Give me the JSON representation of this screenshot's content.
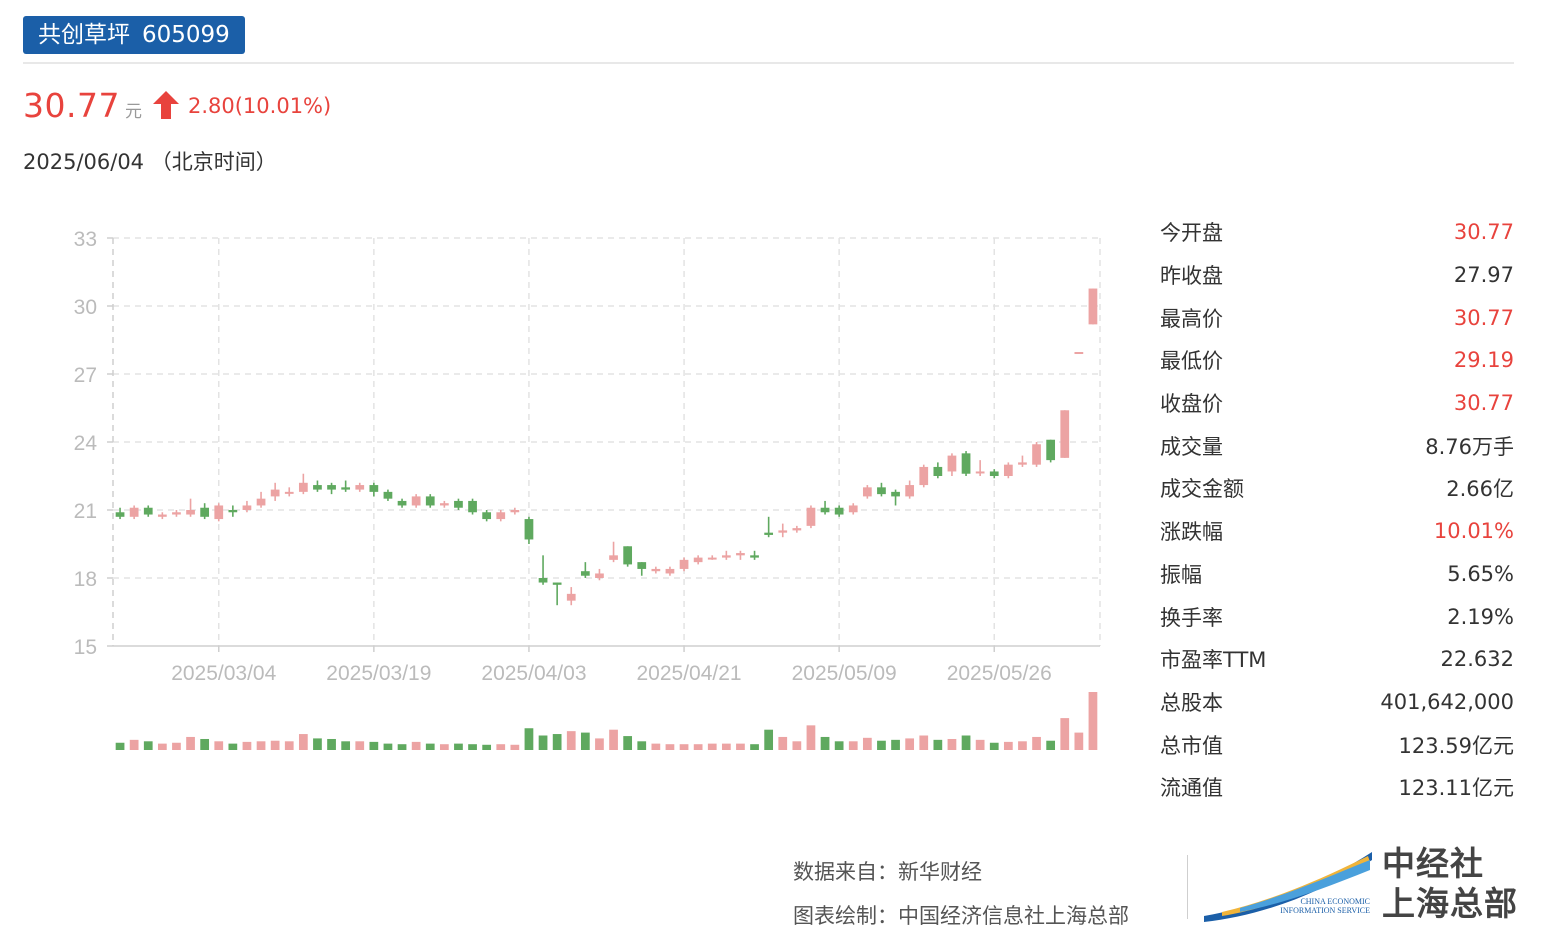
{
  "header": {
    "stock_name": "共创草坪",
    "stock_code": "605099",
    "price": "30.77",
    "price_unit": "元",
    "change": "2.80(10.01%)",
    "date": "2025/06/04 （北京时间）"
  },
  "colors": {
    "up": "#e8433d",
    "candle_up": "#eca3a3",
    "candle_down": "#5fa95f",
    "tag_bg": "#1b5fa8"
  },
  "stats": [
    {
      "label": "今开盘",
      "value": "30.77",
      "highlight": true
    },
    {
      "label": "昨收盘",
      "value": "27.97",
      "highlight": false
    },
    {
      "label": "最高价",
      "value": "30.77",
      "highlight": true
    },
    {
      "label": "最低价",
      "value": "29.19",
      "highlight": true
    },
    {
      "label": "收盘价",
      "value": "30.77",
      "highlight": true
    },
    {
      "label": "成交量",
      "value": "8.76万手",
      "highlight": false
    },
    {
      "label": "成交金额",
      "value": "2.66亿",
      "highlight": false
    },
    {
      "label": "涨跌幅",
      "value": "10.01%",
      "highlight": true
    },
    {
      "label": "振幅",
      "value": "5.65%",
      "highlight": false
    },
    {
      "label": "换手率",
      "value": "2.19%",
      "highlight": false
    },
    {
      "label": "市盈率TTM",
      "value": "22.632",
      "highlight": false
    },
    {
      "label": "总股本",
      "value": "401,642,000",
      "highlight": false
    },
    {
      "label": "总市值",
      "value": "123.59亿元",
      "highlight": false
    },
    {
      "label": "流通值",
      "value": "123.11亿元",
      "highlight": false
    }
  ],
  "footer": {
    "source": "数据来自：新华财经",
    "credit": "图表绘制：中国经济信息社上海总部",
    "logo_line1": "中经社",
    "logo_line2": "上海总部",
    "logo_small1": "CHINA ECONOMIC",
    "logo_small2": "INFORMATION SERVICE"
  },
  "chart_data": {
    "type": "candlestick",
    "y_ticks": [
      33,
      30,
      27,
      24,
      21,
      18,
      15
    ],
    "ylim": [
      15,
      33
    ],
    "x_tick_labels": [
      "2025/03/04",
      "2025/03/19",
      "2025/04/03",
      "2025/04/21",
      "2025/05/09",
      "2025/05/26"
    ],
    "x_tick_indices": [
      7,
      18,
      29,
      40,
      51,
      62
    ],
    "grid": true,
    "candles": [
      {
        "o": 20.9,
        "c": 20.7,
        "h": 21.1,
        "l": 20.6,
        "v": 0.25
      },
      {
        "o": 20.7,
        "c": 21.1,
        "h": 21.2,
        "l": 20.6,
        "v": 0.35
      },
      {
        "o": 21.1,
        "c": 20.8,
        "h": 21.2,
        "l": 20.7,
        "v": 0.3
      },
      {
        "o": 20.7,
        "c": 20.8,
        "h": 20.9,
        "l": 20.6,
        "v": 0.22
      },
      {
        "o": 20.8,
        "c": 20.9,
        "h": 21.0,
        "l": 20.7,
        "v": 0.25
      },
      {
        "o": 20.8,
        "c": 21.0,
        "h": 21.5,
        "l": 20.7,
        "v": 0.45
      },
      {
        "o": 21.1,
        "c": 20.7,
        "h": 21.3,
        "l": 20.6,
        "v": 0.38
      },
      {
        "o": 20.6,
        "c": 21.2,
        "h": 21.3,
        "l": 20.5,
        "v": 0.3
      },
      {
        "o": 21.0,
        "c": 20.9,
        "h": 21.2,
        "l": 20.7,
        "v": 0.22
      },
      {
        "o": 21.0,
        "c": 21.2,
        "h": 21.4,
        "l": 20.9,
        "v": 0.28
      },
      {
        "o": 21.2,
        "c": 21.5,
        "h": 21.8,
        "l": 21.1,
        "v": 0.3
      },
      {
        "o": 21.6,
        "c": 21.9,
        "h": 22.2,
        "l": 21.4,
        "v": 0.32
      },
      {
        "o": 21.8,
        "c": 21.8,
        "h": 22.0,
        "l": 21.6,
        "v": 0.3
      },
      {
        "o": 21.8,
        "c": 22.2,
        "h": 22.6,
        "l": 21.7,
        "v": 0.55
      },
      {
        "o": 22.1,
        "c": 21.9,
        "h": 22.3,
        "l": 21.8,
        "v": 0.4
      },
      {
        "o": 22.1,
        "c": 21.9,
        "h": 22.2,
        "l": 21.7,
        "v": 0.38
      },
      {
        "o": 22.0,
        "c": 21.9,
        "h": 22.3,
        "l": 21.8,
        "v": 0.3
      },
      {
        "o": 21.9,
        "c": 22.1,
        "h": 22.2,
        "l": 21.8,
        "v": 0.3
      },
      {
        "o": 22.1,
        "c": 21.8,
        "h": 22.2,
        "l": 21.6,
        "v": 0.28
      },
      {
        "o": 21.8,
        "c": 21.5,
        "h": 21.9,
        "l": 21.4,
        "v": 0.22
      },
      {
        "o": 21.4,
        "c": 21.2,
        "h": 21.5,
        "l": 21.1,
        "v": 0.2
      },
      {
        "o": 21.2,
        "c": 21.6,
        "h": 21.7,
        "l": 21.1,
        "v": 0.28
      },
      {
        "o": 21.6,
        "c": 21.2,
        "h": 21.7,
        "l": 21.1,
        "v": 0.22
      },
      {
        "o": 21.2,
        "c": 21.3,
        "h": 21.4,
        "l": 21.1,
        "v": 0.2
      },
      {
        "o": 21.4,
        "c": 21.1,
        "h": 21.5,
        "l": 21.0,
        "v": 0.22
      },
      {
        "o": 21.4,
        "c": 20.9,
        "h": 21.5,
        "l": 20.8,
        "v": 0.2
      },
      {
        "o": 20.9,
        "c": 20.6,
        "h": 21.0,
        "l": 20.5,
        "v": 0.18
      },
      {
        "o": 20.6,
        "c": 20.9,
        "h": 21.0,
        "l": 20.5,
        "v": 0.2
      },
      {
        "o": 20.9,
        "c": 21.0,
        "h": 21.1,
        "l": 20.8,
        "v": 0.18
      },
      {
        "o": 20.6,
        "c": 19.7,
        "h": 20.7,
        "l": 19.5,
        "v": 0.75
      },
      {
        "o": 18.0,
        "c": 17.8,
        "h": 19.0,
        "l": 17.7,
        "v": 0.5
      },
      {
        "o": 17.8,
        "c": 17.7,
        "h": 17.8,
        "l": 16.8,
        "v": 0.55
      },
      {
        "o": 17.0,
        "c": 17.3,
        "h": 17.6,
        "l": 16.8,
        "v": 0.65
      },
      {
        "o": 18.3,
        "c": 18.1,
        "h": 18.7,
        "l": 18.0,
        "v": 0.6
      },
      {
        "o": 18.0,
        "c": 18.2,
        "h": 18.4,
        "l": 17.9,
        "v": 0.4
      },
      {
        "o": 18.8,
        "c": 19.0,
        "h": 19.6,
        "l": 18.7,
        "v": 0.7
      },
      {
        "o": 19.4,
        "c": 18.6,
        "h": 19.4,
        "l": 18.5,
        "v": 0.48
      },
      {
        "o": 18.7,
        "c": 18.4,
        "h": 18.7,
        "l": 18.1,
        "v": 0.3
      },
      {
        "o": 18.3,
        "c": 18.4,
        "h": 18.5,
        "l": 18.2,
        "v": 0.22
      },
      {
        "o": 18.2,
        "c": 18.4,
        "h": 18.5,
        "l": 18.1,
        "v": 0.2
      },
      {
        "o": 18.4,
        "c": 18.8,
        "h": 18.9,
        "l": 18.3,
        "v": 0.2
      },
      {
        "o": 18.7,
        "c": 18.9,
        "h": 19.0,
        "l": 18.6,
        "v": 0.2
      },
      {
        "o": 18.9,
        "c": 18.9,
        "h": 19.0,
        "l": 18.8,
        "v": 0.22
      },
      {
        "o": 18.9,
        "c": 19.0,
        "h": 19.2,
        "l": 18.8,
        "v": 0.22
      },
      {
        "o": 19.0,
        "c": 19.1,
        "h": 19.2,
        "l": 18.8,
        "v": 0.22
      },
      {
        "o": 19.0,
        "c": 18.9,
        "h": 19.2,
        "l": 18.8,
        "v": 0.2
      },
      {
        "o": 20.0,
        "c": 19.9,
        "h": 20.7,
        "l": 19.8,
        "v": 0.7
      },
      {
        "o": 20.0,
        "c": 20.1,
        "h": 20.4,
        "l": 19.8,
        "v": 0.45
      },
      {
        "o": 20.1,
        "c": 20.2,
        "h": 20.3,
        "l": 20.0,
        "v": 0.3
      },
      {
        "o": 20.3,
        "c": 21.1,
        "h": 21.2,
        "l": 20.2,
        "v": 0.85
      },
      {
        "o": 21.1,
        "c": 20.9,
        "h": 21.4,
        "l": 20.8,
        "v": 0.45
      },
      {
        "o": 21.1,
        "c": 20.8,
        "h": 21.2,
        "l": 20.7,
        "v": 0.3
      },
      {
        "o": 20.9,
        "c": 21.2,
        "h": 21.3,
        "l": 20.8,
        "v": 0.3
      },
      {
        "o": 21.6,
        "c": 22.0,
        "h": 22.1,
        "l": 21.5,
        "v": 0.42
      },
      {
        "o": 22.0,
        "c": 21.7,
        "h": 22.2,
        "l": 21.6,
        "v": 0.32
      },
      {
        "o": 21.8,
        "c": 21.6,
        "h": 21.9,
        "l": 21.2,
        "v": 0.35
      },
      {
        "o": 21.6,
        "c": 22.1,
        "h": 22.3,
        "l": 21.5,
        "v": 0.4
      },
      {
        "o": 22.1,
        "c": 22.9,
        "h": 23.0,
        "l": 22.0,
        "v": 0.5
      },
      {
        "o": 22.9,
        "c": 22.5,
        "h": 23.1,
        "l": 22.4,
        "v": 0.35
      },
      {
        "o": 22.7,
        "c": 23.4,
        "h": 23.5,
        "l": 22.5,
        "v": 0.38
      },
      {
        "o": 23.5,
        "c": 22.6,
        "h": 23.6,
        "l": 22.5,
        "v": 0.5
      },
      {
        "o": 22.7,
        "c": 22.7,
        "h": 23.2,
        "l": 22.5,
        "v": 0.35
      },
      {
        "o": 22.7,
        "c": 22.5,
        "h": 22.8,
        "l": 22.4,
        "v": 0.25
      },
      {
        "o": 22.5,
        "c": 23.0,
        "h": 23.1,
        "l": 22.4,
        "v": 0.28
      },
      {
        "o": 23.0,
        "c": 23.1,
        "h": 23.4,
        "l": 22.9,
        "v": 0.3
      },
      {
        "o": 23.0,
        "c": 23.9,
        "h": 24.0,
        "l": 22.9,
        "v": 0.45
      },
      {
        "o": 24.1,
        "c": 23.2,
        "h": 24.1,
        "l": 23.1,
        "v": 0.32
      },
      {
        "o": 23.3,
        "c": 25.4,
        "h": 25.4,
        "l": 23.3,
        "v": 1.1
      },
      {
        "o": 27.97,
        "c": 27.97,
        "h": 27.97,
        "l": 27.97,
        "v": 0.6
      },
      {
        "o": 29.19,
        "c": 30.77,
        "h": 30.77,
        "l": 29.19,
        "v": 2.0
      }
    ]
  }
}
